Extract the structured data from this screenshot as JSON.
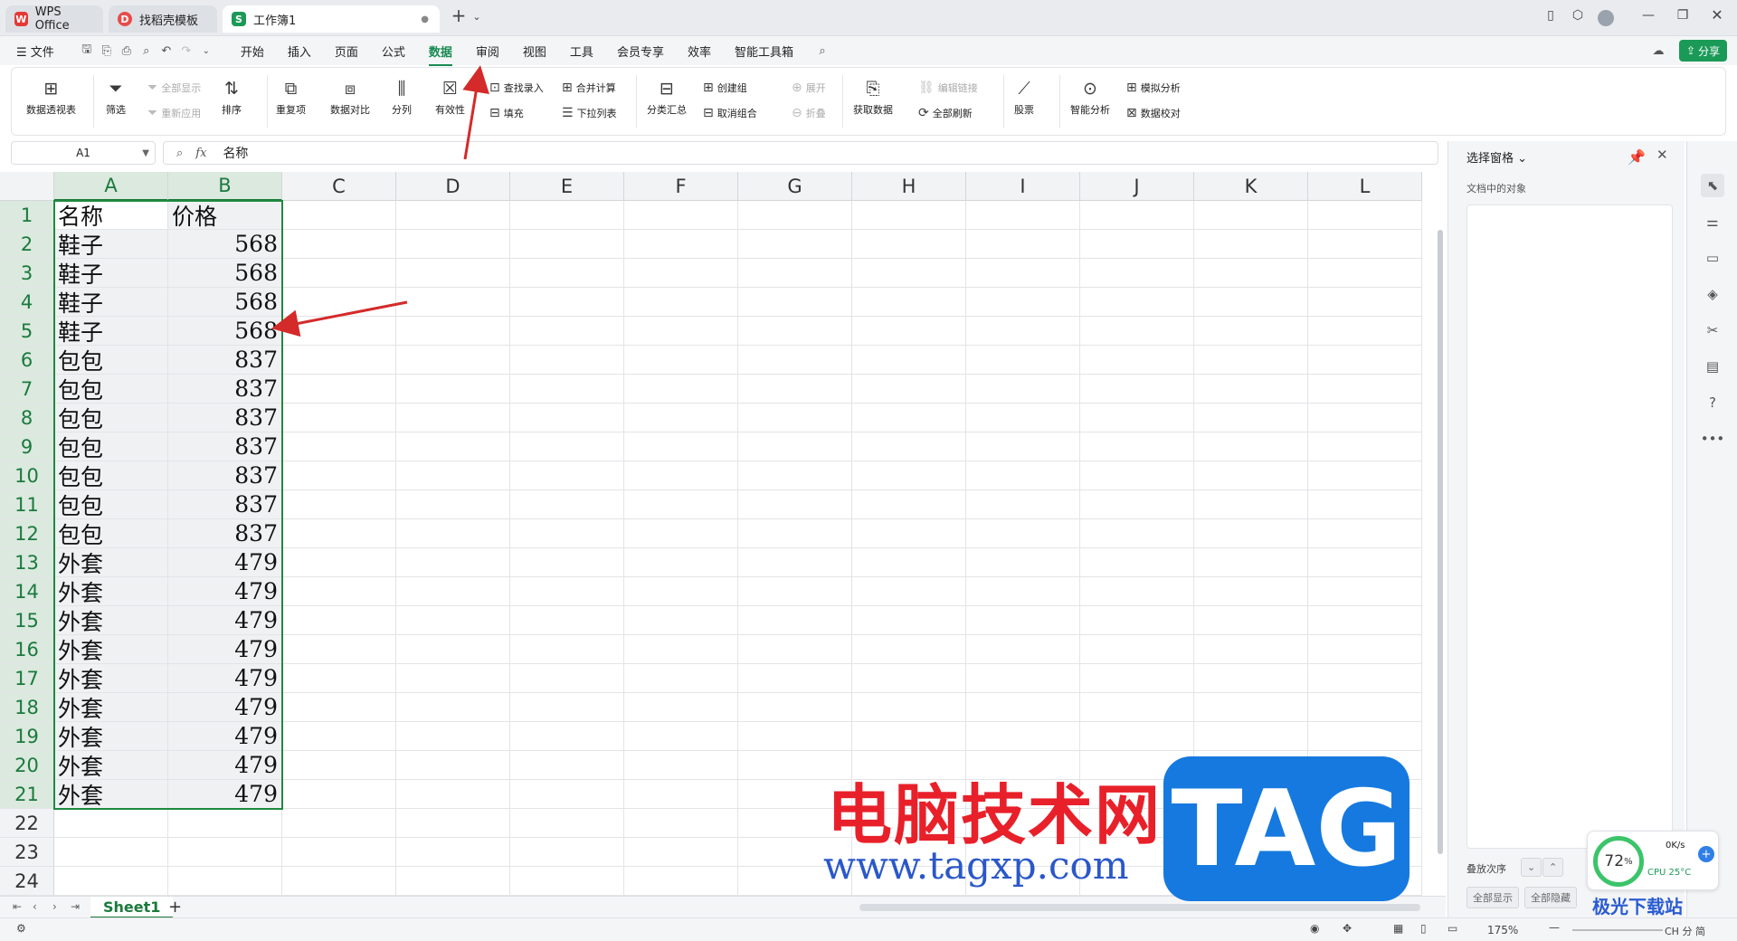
{
  "tabs": [
    {
      "label": "WPS Office"
    },
    {
      "label": "找稻壳模板"
    },
    {
      "label": "工作簿1"
    }
  ],
  "menu": {
    "file": "文件",
    "items": [
      "开始",
      "插入",
      "页面",
      "公式",
      "数据",
      "审阅",
      "视图",
      "工具",
      "会员专享",
      "效率",
      "智能工具箱"
    ],
    "active": "数据",
    "share": "分享"
  },
  "ribbon": {
    "pivot": "数据透视表",
    "filter": "筛选",
    "show_all": "全部显示",
    "reapply": "重新应用",
    "sort": "排序",
    "duplicates": "重复项",
    "compare": "数据对比",
    "split": "分列",
    "validity": "有效性",
    "lookup_entry": "查找录入",
    "fill": "填充",
    "consolidate": "合并计算",
    "dropdown_list": "下拉列表",
    "subtotal": "分类汇总",
    "create_group": "创建组",
    "ungroup": "取消组合",
    "expand": "展开",
    "collapse": "折叠",
    "get_data": "获取数据",
    "edit_links": "编辑链接",
    "refresh_all": "全部刷新",
    "stocks": "股票",
    "smart_analysis": "智能分析",
    "simulation": "模拟分析",
    "data_check": "数据校对"
  },
  "formula_bar": {
    "cell_ref": "A1",
    "fx": "fx",
    "value": "名称"
  },
  "columns": [
    "A",
    "B",
    "C",
    "D",
    "E",
    "F",
    "G",
    "H",
    "I",
    "J",
    "K",
    "L"
  ],
  "rows": [
    "1",
    "2",
    "3",
    "4",
    "5",
    "6",
    "7",
    "8",
    "9",
    "10",
    "11",
    "12",
    "13",
    "14",
    "15",
    "16",
    "17",
    "18",
    "19",
    "20",
    "21",
    "22",
    "23",
    "24"
  ],
  "table": {
    "headers": [
      "名称",
      "价格"
    ],
    "rows": [
      [
        "鞋子",
        "568"
      ],
      [
        "鞋子",
        "568"
      ],
      [
        "鞋子",
        "568"
      ],
      [
        "鞋子",
        "568"
      ],
      [
        "包包",
        "837"
      ],
      [
        "包包",
        "837"
      ],
      [
        "包包",
        "837"
      ],
      [
        "包包",
        "837"
      ],
      [
        "包包",
        "837"
      ],
      [
        "包包",
        "837"
      ],
      [
        "包包",
        "837"
      ],
      [
        "外套",
        "479"
      ],
      [
        "外套",
        "479"
      ],
      [
        "外套",
        "479"
      ],
      [
        "外套",
        "479"
      ],
      [
        "外套",
        "479"
      ],
      [
        "外套",
        "479"
      ],
      [
        "外套",
        "479"
      ],
      [
        "外套",
        "479"
      ],
      [
        "外套",
        "479"
      ]
    ]
  },
  "sheet_tabs": [
    "Sheet1"
  ],
  "selection_pane": {
    "title": "选择窗格",
    "subtitle": "文档中的对象",
    "order_label": "叠放次序",
    "show_all": "全部显示",
    "hide_all": "全部隐藏"
  },
  "status": {
    "zoom": "175%",
    "cpu_percent": "72",
    "net": "0K/s",
    "cpu": "CPU 25°C",
    "ime": "CH 分 简"
  },
  "watermark": {
    "title": "电脑技术网",
    "url": "www.tagxp.com",
    "logo": "TAG",
    "site": "极光下载站"
  },
  "colors": {
    "accent": "#178a51",
    "selection_border": "#1e8a3f",
    "annotation_arrow": "#d42a2a"
  }
}
